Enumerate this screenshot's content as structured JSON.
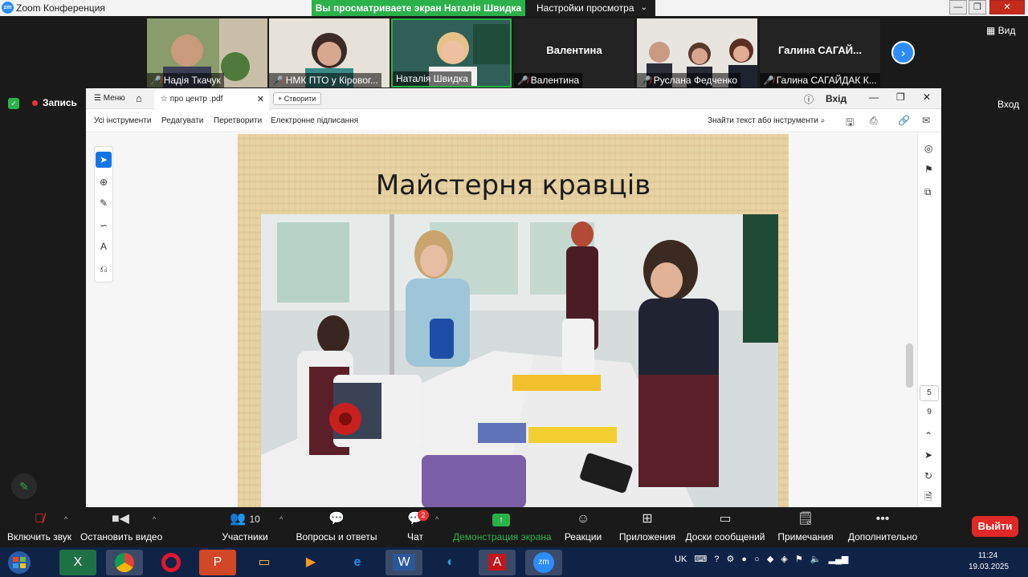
{
  "window": {
    "title": "Zoom Конференция",
    "share_banner": "Вы просматриваете экран Наталія Швидка",
    "view_settings": "Настройки просмотра",
    "minimize": "—",
    "maximize": "❐",
    "close": "✕"
  },
  "participants": [
    {
      "name": "Надія Ткачук",
      "muted": true,
      "has_video": true,
      "color": "#6b7a5a"
    },
    {
      "name": "НМК ПТО у Кіровог...",
      "muted": true,
      "has_video": true,
      "color": "#d8d2c8"
    },
    {
      "name": "Наталія Швидка",
      "muted": false,
      "has_video": true,
      "active": true,
      "color": "#2e6a62"
    },
    {
      "name": "Валентина",
      "big_label": "Валентина",
      "muted": true,
      "has_video": false
    },
    {
      "name": "Руслана Федченко",
      "muted": true,
      "has_video": true,
      "color": "#e7e3de"
    },
    {
      "name": "Галина САГАЙДАК К...",
      "big_label": "Галина  САГАЙ...",
      "muted": true,
      "has_video": false
    }
  ],
  "view_button": "Вид",
  "record": "Запись",
  "login_right": "Вход",
  "acrobat": {
    "menu": "Меню",
    "tab_name": "про центр .pdf",
    "create": "Створити",
    "login": "Вхід",
    "toolbar": [
      "Усі інструменти",
      "Редагувати",
      "Перетворити",
      "Електронне підписання"
    ],
    "search_label": "Знайти текст або інструменти",
    "page_current": "5",
    "page_total": "9"
  },
  "slide": {
    "title": "Майстерня кравців"
  },
  "zoom_toolbar": {
    "unmute": "Включить звук",
    "video": "Остановить видео",
    "participants": "Участники",
    "participants_count": "10",
    "qa": "Вопросы и ответы",
    "chat": "Чат",
    "chat_badge": "2",
    "share": "Демонстрация экрана",
    "reactions": "Реакции",
    "apps": "Приложения",
    "whiteboards": "Доски сообщений",
    "notes": "Примечания",
    "more": "Дополнительно",
    "leave": "Выйти"
  },
  "taskbar": {
    "lang": "UK",
    "time": "11:24",
    "date": "19.03.2025"
  }
}
